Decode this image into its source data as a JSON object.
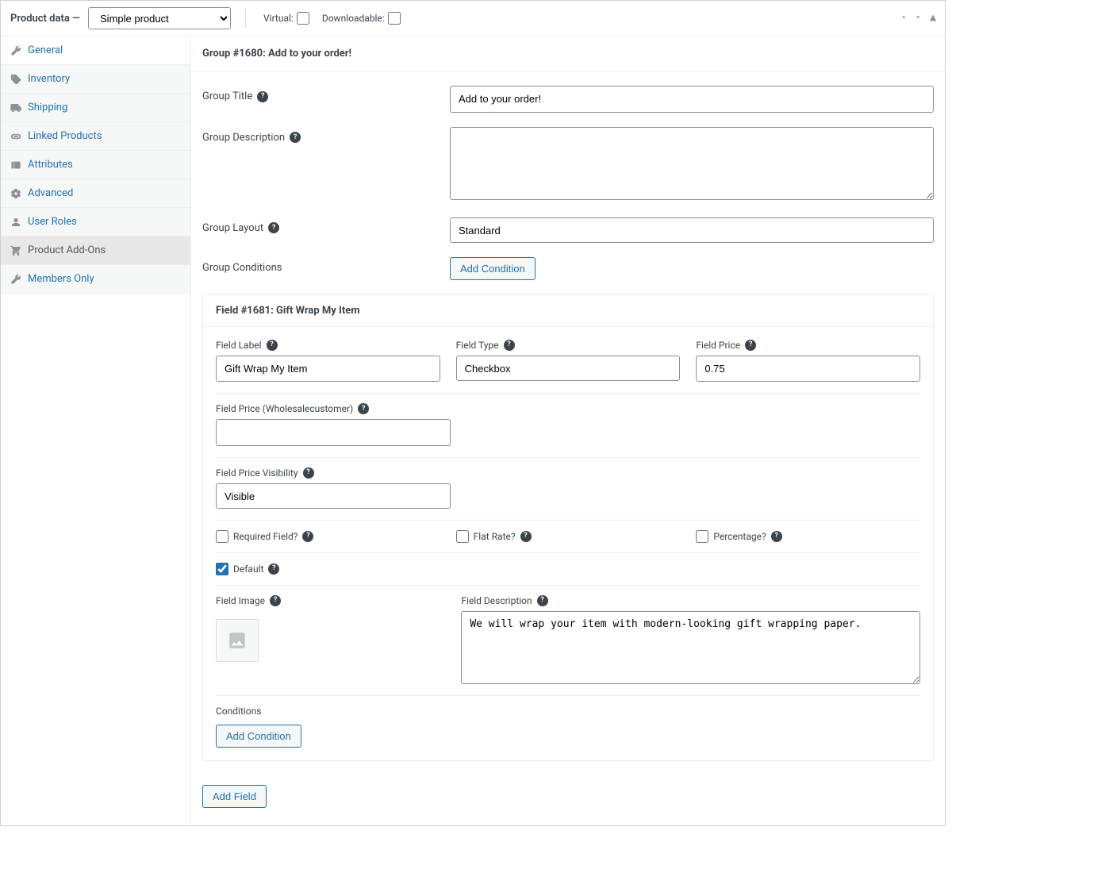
{
  "header": {
    "title_prefix": "Product data",
    "dash": "—",
    "product_type": "Simple product",
    "virtual_label": "Virtual:",
    "downloadable_label": "Downloadable:"
  },
  "tabs": [
    {
      "id": "general",
      "label": "General"
    },
    {
      "id": "inventory",
      "label": "Inventory"
    },
    {
      "id": "shipping",
      "label": "Shipping"
    },
    {
      "id": "linked",
      "label": "Linked Products"
    },
    {
      "id": "attributes",
      "label": "Attributes"
    },
    {
      "id": "advanced",
      "label": "Advanced"
    },
    {
      "id": "userroles",
      "label": "User Roles"
    },
    {
      "id": "addons",
      "label": "Product Add-Ons"
    },
    {
      "id": "members",
      "label": "Members Only"
    }
  ],
  "group": {
    "header": "Group #1680: Add to your order!",
    "title_label": "Group Title",
    "title_value": "Add to your order!",
    "desc_label": "Group Description",
    "desc_value": "",
    "layout_label": "Group Layout",
    "layout_value": "Standard",
    "conditions_label": "Group Conditions",
    "add_condition_btn": "Add Condition"
  },
  "field": {
    "header": "Field #1681: Gift Wrap My Item",
    "label_label": "Field Label",
    "label_value": "Gift Wrap My Item",
    "type_label": "Field Type",
    "type_value": "Checkbox",
    "price_label": "Field Price",
    "price_value": "0.75",
    "price_whole_label": "Field Price (Wholesalecustomer)",
    "price_whole_value": "",
    "price_vis_label": "Field Price Visibility",
    "price_vis_value": "Visible",
    "required_label": "Required Field?",
    "flat_label": "Flat Rate?",
    "percentage_label": "Percentage?",
    "default_label": "Default",
    "image_label": "Field Image",
    "desc_label": "Field Description",
    "desc_value": "We will wrap your item with modern-looking gift wrapping paper.",
    "conditions_label": "Conditions",
    "add_condition_btn": "Add Condition"
  },
  "buttons": {
    "add_field": "Add Field"
  }
}
